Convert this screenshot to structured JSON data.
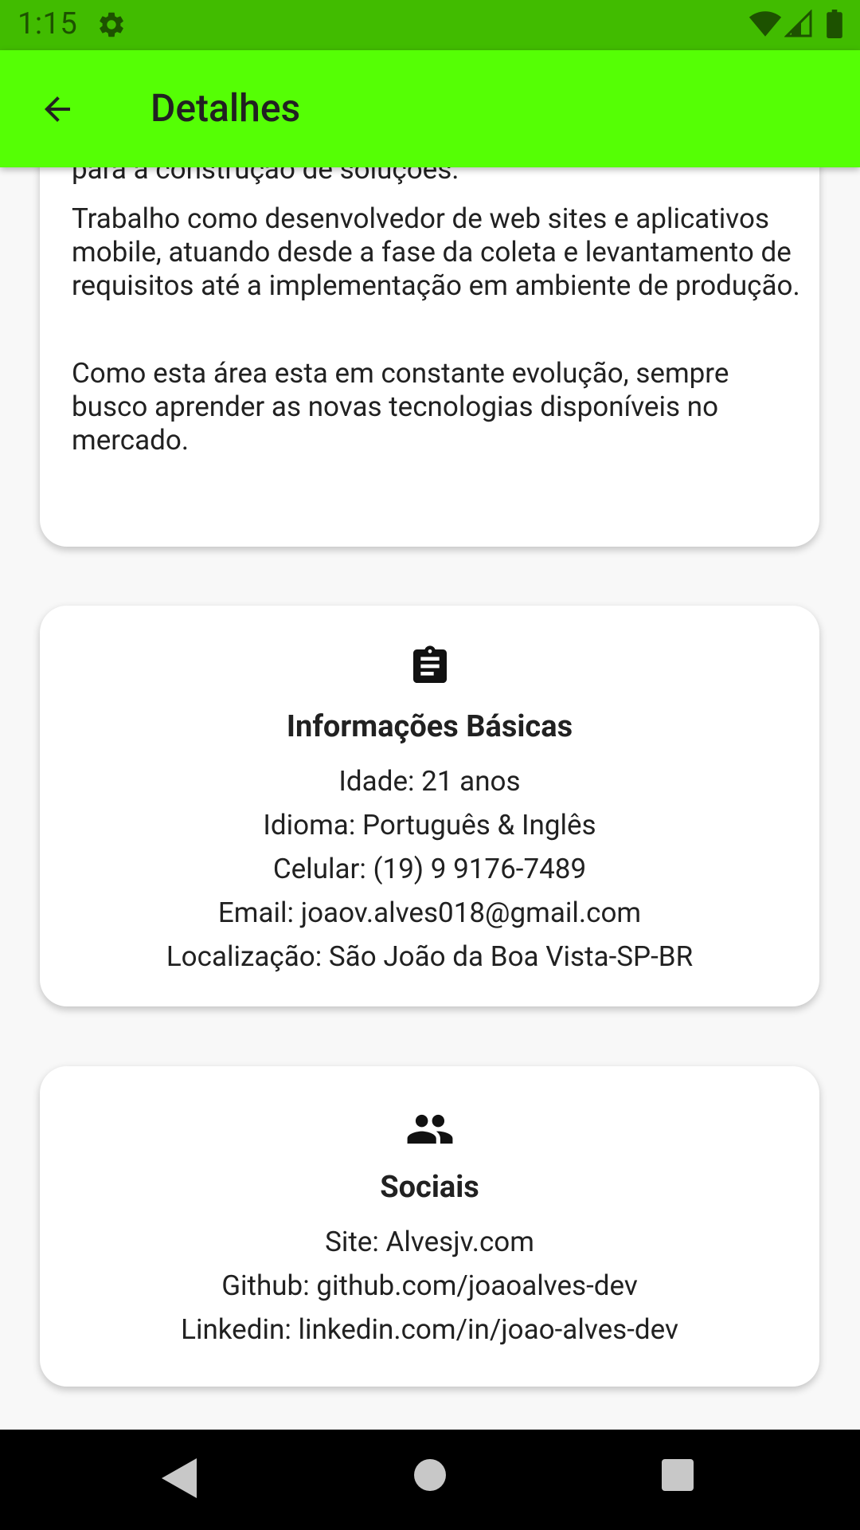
{
  "status_bar": {
    "time": "1:15",
    "icons": [
      "settings-icon",
      "wifi-icon",
      "signal-icon",
      "battery-icon"
    ]
  },
  "app_bar": {
    "title": "Detalhes",
    "back_icon": "arrow-back-icon",
    "background": "#55ff05"
  },
  "about_card": {
    "paragraphs": [
      "tecnologia juntamente com a união de diferentes áreas para a construção de soluções.",
      "Trabalho como desenvolvedor de web sites e aplicativos mobile, atuando desde a fase da coleta e levantamento de requisitos até a implementação em ambiente de produção.",
      "Como esta área esta em constante evolução, sempre busco aprender as novas tecnologias disponíveis no mercado."
    ]
  },
  "basic_info_card": {
    "icon": "clipboard-icon",
    "title": "Informações Básicas",
    "lines": [
      "Idade: 21 anos",
      "Idioma: Português & Inglês",
      "Celular: (19) 9 9176-7489",
      "Email: joaov.alves018@gmail.com",
      "Localização: São João da Boa Vista-SP-BR"
    ]
  },
  "social_card": {
    "icon": "people-icon",
    "title": "Sociais",
    "lines": [
      "Site: Alvesjv.com",
      "Github: github.com/joaoalves-dev",
      "Linkedin: linkedin.com/in/joao-alves-dev"
    ]
  },
  "nav_bar": {
    "buttons": [
      "nav-back-icon",
      "nav-home-icon",
      "nav-recents-icon"
    ]
  },
  "colors": {
    "status_bar": "#41bc00",
    "app_bar": "#55ff05",
    "background": "#f8f8f8",
    "card": "#ffffff"
  }
}
